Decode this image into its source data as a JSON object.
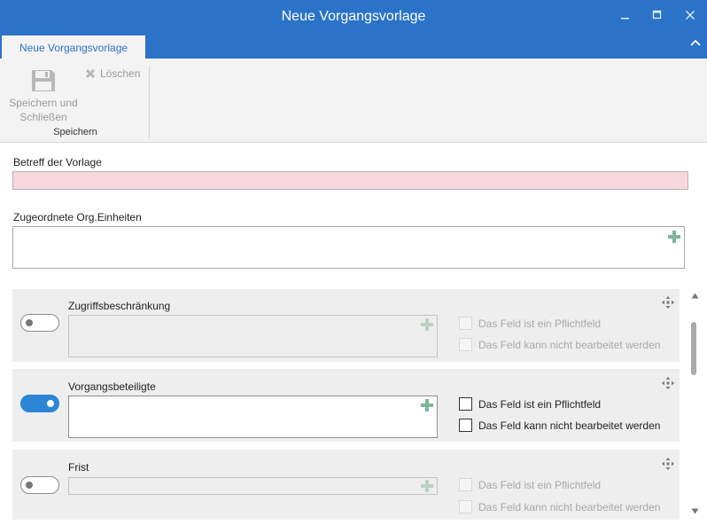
{
  "window": {
    "title": "Neue Vorgangsvorlage",
    "accent_color": "#2b73c9",
    "controls": [
      "minimize-icon",
      "maximize-icon",
      "close-icon"
    ]
  },
  "tab": {
    "label": "Neue Vorgangsvorlage"
  },
  "ribbon": {
    "save_label": "Speichern und Schließen",
    "delete_label": "Löschen",
    "group_label": "Speichern"
  },
  "form": {
    "subject": {
      "label": "Betreff der Vorlage",
      "value": "",
      "invalid_color": "#f8d7df"
    },
    "org_units": {
      "label": "Zugeordnete Org.Einheiten"
    }
  },
  "panels": [
    {
      "title": "Zugriffsbeschränkung",
      "enabled": false,
      "required_label": "Das Feld ist ein Pflichtfeld",
      "readonly_label": "Das Feld kann nicht bearbeitet werden"
    },
    {
      "title": "Vorgangsbeteiligte",
      "enabled": true,
      "required_label": "Das Feld ist ein Pflichtfeld",
      "readonly_label": "Das Feld kann nicht bearbeitet werden"
    },
    {
      "title": "Frist",
      "enabled": false,
      "required_label": "Das Feld ist ein Pflichtfeld",
      "readonly_label": "Das Feld kann nicht bearbeitet werden"
    }
  ]
}
